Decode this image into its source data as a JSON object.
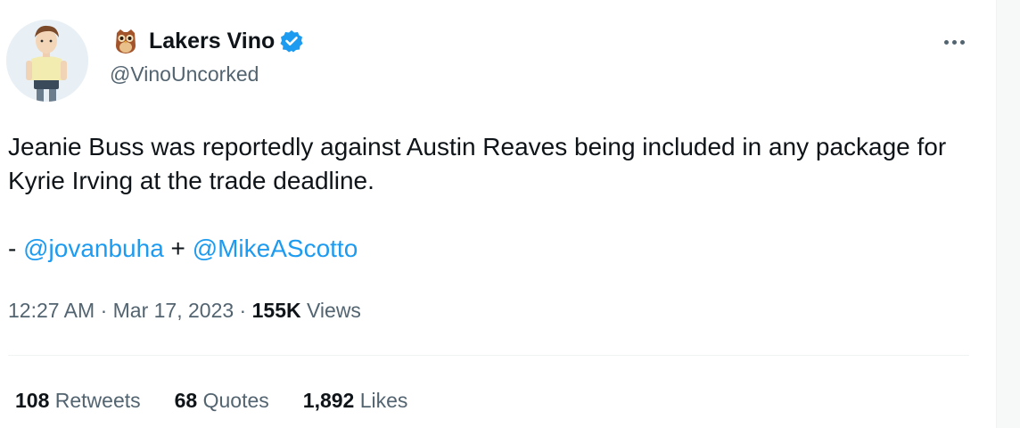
{
  "author": {
    "display_name": "Lakers Vino",
    "handle": "@VinoUncorked",
    "emoji_icon": "owl-icon",
    "verified": true,
    "verified_color": "#1d9bf0"
  },
  "tweet": {
    "text": "Jeanie Buss was reportedly against Austin Reaves being included in any package for Kyrie Irving at the trade deadline.",
    "credit_prefix": "- ",
    "mention_1": "@jovanbuha",
    "credit_joiner": " + ",
    "mention_2": "@MikeAScotto"
  },
  "meta": {
    "time": "12:27 AM",
    "sep1": " · ",
    "date": "Mar 17, 2023",
    "sep2": " · ",
    "views_count": "155K",
    "views_label": " Views"
  },
  "stats": {
    "retweets_count": "108",
    "retweets_label": " Retweets",
    "quotes_count": "68",
    "quotes_label": " Quotes",
    "likes_count": "1,892",
    "likes_label": " Likes"
  },
  "colors": {
    "link": "#1d9bf0",
    "secondary_text": "#536471",
    "primary_text": "#0f1419"
  }
}
